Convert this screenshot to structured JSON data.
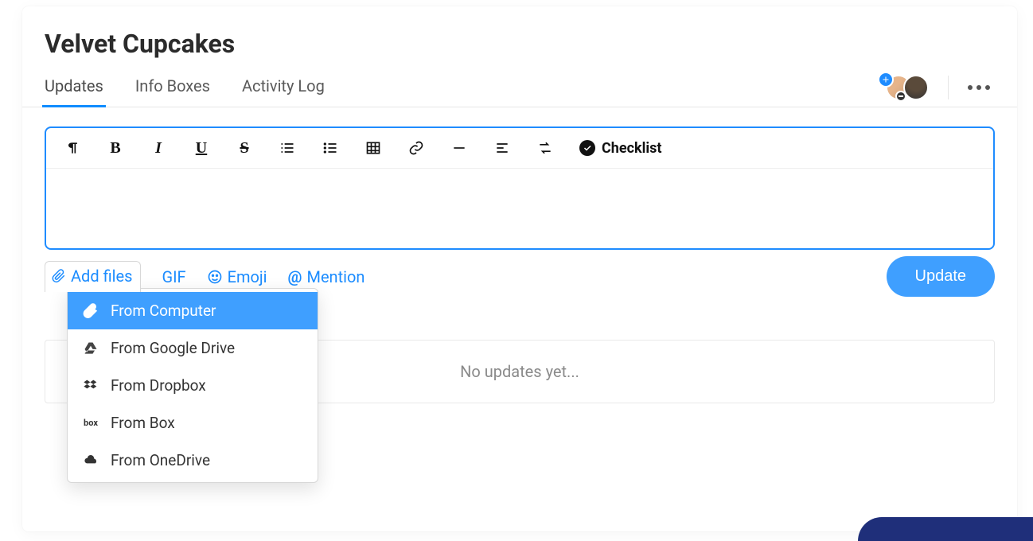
{
  "title": "Velvet Cupcakes",
  "tabs": [
    {
      "label": "Updates",
      "active": true
    },
    {
      "label": "Info Boxes",
      "active": false
    },
    {
      "label": "Activity Log",
      "active": false
    }
  ],
  "toolbar": {
    "paragraph_icon": "paragraph",
    "bold": "B",
    "italic": "I",
    "underline": "U",
    "strike": "S",
    "ol_icon": "ordered-list",
    "ul_icon": "unordered-list",
    "table_icon": "table",
    "link_icon": "link",
    "hr_icon": "horizontal-rule",
    "align_icon": "align-left",
    "ltr_icon": "text-direction",
    "checklist_label": "Checklist"
  },
  "attach": {
    "add_files": "Add files",
    "gif": "GIF",
    "emoji": "Emoji",
    "mention_prefix": "@",
    "mention": "Mention"
  },
  "update_button": "Update",
  "dropdown": [
    {
      "label": "From Computer",
      "icon": "paperclip",
      "active": true
    },
    {
      "label": "From Google Drive",
      "icon": "gdrive",
      "active": false
    },
    {
      "label": "From Dropbox",
      "icon": "dropbox",
      "active": false
    },
    {
      "label": "From Box",
      "icon": "box",
      "active": false
    },
    {
      "label": "From OneDrive",
      "icon": "onedrive",
      "active": false
    }
  ],
  "empty_state": "No updates yet...",
  "colors": {
    "accent": "#1f8cff",
    "button": "#3f9fff",
    "corner": "#1f2f7a"
  }
}
